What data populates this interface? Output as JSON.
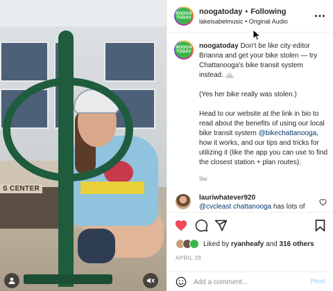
{
  "header": {
    "username": "noogatoday",
    "separator": "•",
    "follow_label": "Following",
    "audio_owner": "lakeisabelmusic",
    "audio_sep": "•",
    "audio_label": "Original Audio",
    "avatar_logo": "NOOGA TODAY",
    "more_icon": "more-horizontal-icon"
  },
  "media": {
    "storefront_sign": "S CENTER",
    "user_tag_icon": "user-tag-icon",
    "mute_icon": "muted-speaker-icon"
  },
  "caption": {
    "username": "noogatoday",
    "para1": "Don't be like city editor Brianna and get your bike stolen — try Chattanooga's bike transit system instead. 🚲",
    "para2": "(Yes her bike really was stolen.)",
    "para3_a": "Head to our website at the link in bio to read about the benefits of using our local bike transit system ",
    "para3_mention": "@bikechattanooga",
    "para3_b": ", how it works, and our tips and tricks for utilizing it (like the app you can use to find the closest station + plan routes).",
    "age": "9w"
  },
  "comment": {
    "username": "lauriwhatever920",
    "mention1": "@cvcleast",
    "mention2": "chattanooga",
    "text_tail": "has lots of"
  },
  "actions": {
    "like_icon": "heart-filled-icon",
    "comment_icon": "comment-icon",
    "share_icon": "share-icon",
    "save_icon": "bookmark-icon",
    "liked": true
  },
  "likes": {
    "prefix": "Liked by",
    "user": "ryanheafy",
    "conj": "and",
    "count": "316 others"
  },
  "date": "APRIL 29",
  "add_comment": {
    "placeholder": "Add a comment...",
    "post_label": "Post",
    "emoji_icon": "emoji-icon"
  },
  "colors": {
    "like_red": "#ed4956",
    "mention_blue": "#00376b",
    "post_disabled": "#b2dffc",
    "brand_green": "#3bb54a"
  }
}
